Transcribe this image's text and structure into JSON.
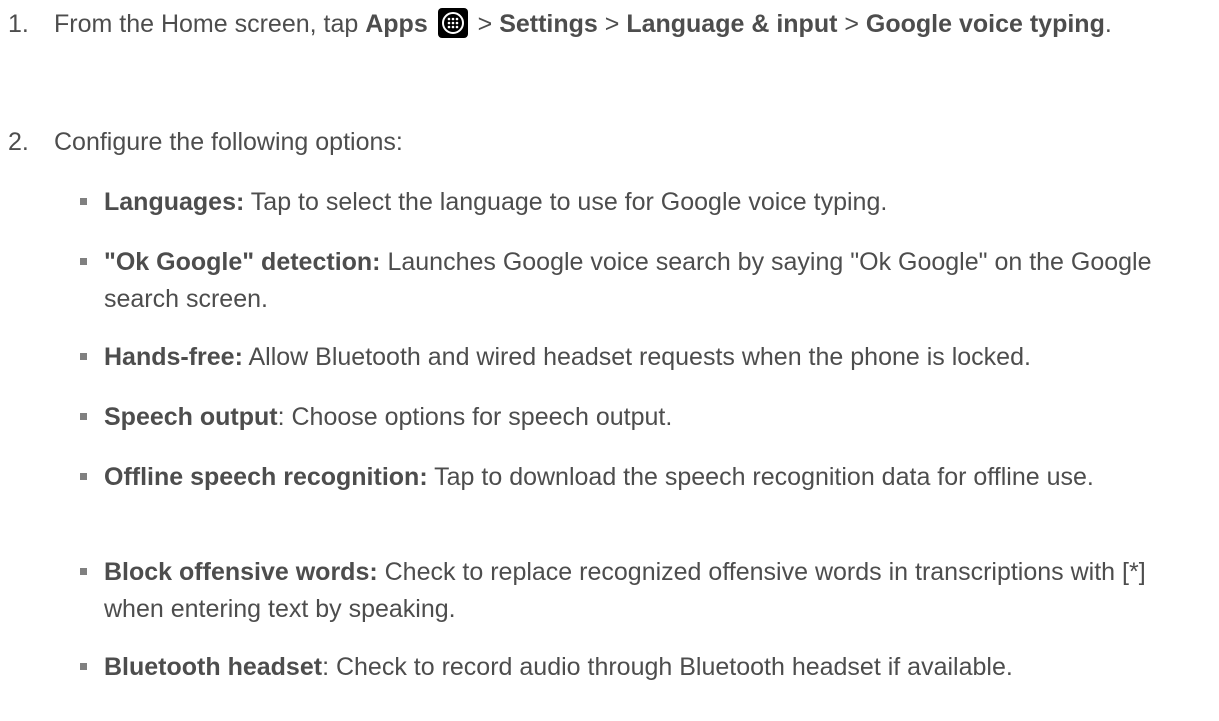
{
  "steps": [
    {
      "number": "1.",
      "prefix": "From the Home screen, tap ",
      "apps": "Apps",
      "sep1": " > ",
      "settings": "Settings",
      "sep2": " > ",
      "language_input": "Language & input",
      "sep3": " > ",
      "google_voice_typing": "Google voice typing",
      "suffix": "."
    },
    {
      "number": "2.",
      "text": "Configure the following options:"
    }
  ],
  "options": [
    {
      "name": "Languages:",
      "desc": " Tap to select the language to use for Google voice typing."
    },
    {
      "name": "\"Ok Google\" detection:",
      "desc": " Launches Google voice search by saying \"Ok Google\" on the Google search screen."
    },
    {
      "name": "Hands-free:",
      "desc": " Allow Bluetooth and wired headset requests when the phone is locked."
    },
    {
      "name": "Speech output",
      "desc": ": Choose options for speech output."
    },
    {
      "name": "Offline speech recognition:",
      "desc": " Tap to download the speech recognition data for offline use."
    },
    {
      "name": "Block offensive words:",
      "desc": " Check to replace recognized offensive words in transcriptions with [*] when entering text by speaking."
    },
    {
      "name": "Bluetooth headset",
      "desc": ": Check to record audio through Bluetooth headset if available."
    }
  ]
}
